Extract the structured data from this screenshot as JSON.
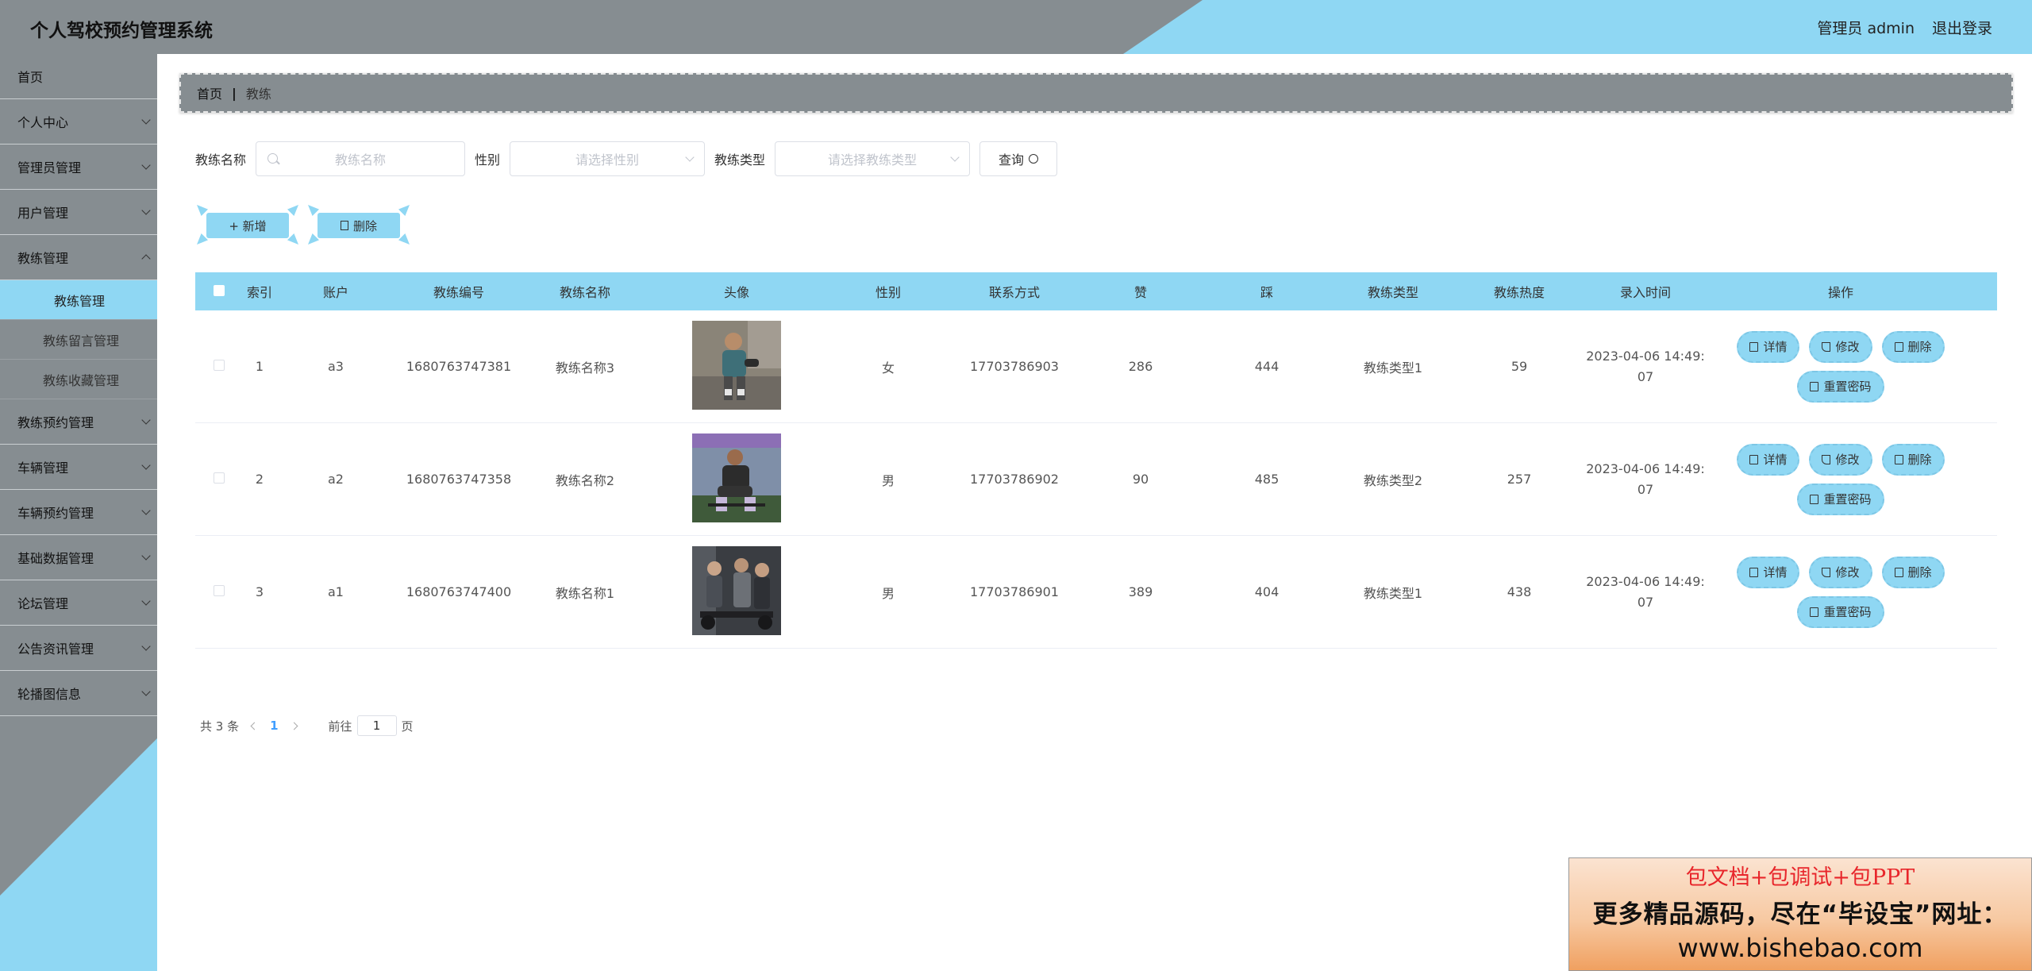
{
  "header": {
    "title": "个人驾校预约管理系统",
    "user": "管理员 admin",
    "logout": "退出登录"
  },
  "sidebar": {
    "items": [
      {
        "label": "首页",
        "has_chevron": false
      },
      {
        "label": "个人中心",
        "has_chevron": true
      },
      {
        "label": "管理员管理",
        "has_chevron": true
      },
      {
        "label": "用户管理",
        "has_chevron": true
      },
      {
        "label": "教练管理",
        "has_chevron": true
      }
    ],
    "sub_items": [
      {
        "label": "教练管理",
        "active": true
      },
      {
        "label": "教练留言管理",
        "active": false
      },
      {
        "label": "教练收藏管理",
        "active": false
      }
    ],
    "items_after": [
      {
        "label": "教练预约管理"
      },
      {
        "label": "车辆管理"
      },
      {
        "label": "车辆预约管理"
      },
      {
        "label": "基础数据管理"
      },
      {
        "label": "论坛管理"
      },
      {
        "label": "公告资讯管理"
      },
      {
        "label": "轮播图信息"
      }
    ]
  },
  "breadcrumb": {
    "home": "首页",
    "separator": "|",
    "current": "教练"
  },
  "search": {
    "name_label": "教练名称",
    "name_placeholder": "教练名称",
    "gender_label": "性别",
    "gender_placeholder": "请选择性别",
    "type_label": "教练类型",
    "type_placeholder": "请选择教练类型",
    "query_label": "查询"
  },
  "actions": {
    "add_label": "+ 新增",
    "delete_label": "删除"
  },
  "table": {
    "headers": [
      "索引",
      "账户",
      "教练编号",
      "教练名称",
      "头像",
      "性别",
      "联系方式",
      "赞",
      "踩",
      "教练类型",
      "教练热度",
      "录入时间",
      "操作"
    ],
    "rows": [
      {
        "index": "1",
        "account": "a3",
        "code": "1680763747381",
        "name": "教练名称3",
        "gender": "女",
        "phone": "17703786903",
        "likes": "286",
        "dislikes": "444",
        "type": "教练类型1",
        "heat": "59",
        "time_line1": "2023-04-06 14:49:",
        "time_line2": "07"
      },
      {
        "index": "2",
        "account": "a2",
        "code": "1680763747358",
        "name": "教练名称2",
        "gender": "男",
        "phone": "17703786902",
        "likes": "90",
        "dislikes": "485",
        "type": "教练类型2",
        "heat": "257",
        "time_line1": "2023-04-06 14:49:",
        "time_line2": "07"
      },
      {
        "index": "3",
        "account": "a1",
        "code": "1680763747400",
        "name": "教练名称1",
        "gender": "男",
        "phone": "17703786901",
        "likes": "389",
        "dislikes": "404",
        "type": "教练类型1",
        "heat": "438",
        "time_line1": "2023-04-06 14:49:",
        "time_line2": "07"
      }
    ],
    "row_actions": {
      "detail": "详情",
      "edit": "修改",
      "delete": "删除",
      "reset": "重置密码"
    }
  },
  "pager": {
    "total": "共 3 条",
    "current": "1",
    "goto_prefix": "前往",
    "goto_value": "1",
    "goto_suffix": "页"
  },
  "ad": {
    "line1": "包文档+包调试+包PPT",
    "line2": "更多精品源码，尽在“毕设宝”网址：",
    "line3": "www.bishebao.com"
  },
  "colors": {
    "accent": "#8fd7f3",
    "gray": "#868d91"
  }
}
